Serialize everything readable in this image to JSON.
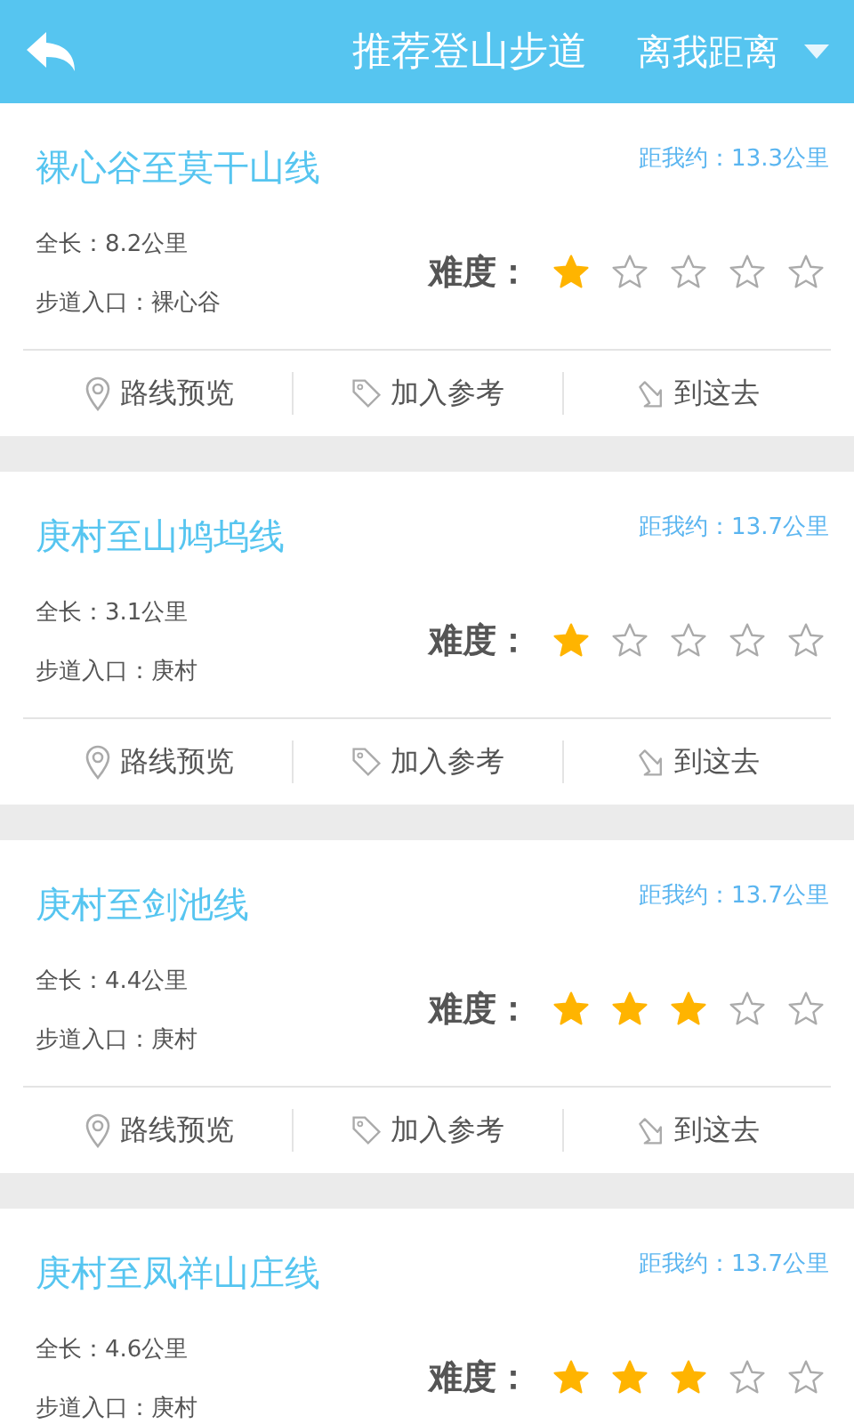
{
  "header": {
    "title": "推荐登山步道",
    "sort": "离我距离"
  },
  "routes": [
    {
      "name": "裸心谷至莫干山线",
      "distance": "距我约：13.3公里",
      "length": "全长：8.2公里",
      "entrance": "步道入口：裸心谷",
      "difficulty_label": "难度：",
      "stars": 1,
      "actions": [
        "路线预览",
        "加入参考",
        "到这去"
      ]
    },
    {
      "name": "庚村至山鸠坞线",
      "distance": "距我约：13.7公里",
      "length": "全长：3.1公里",
      "entrance": "步道入口：庚村",
      "difficulty_label": "难度：",
      "stars": 1,
      "actions": [
        "路线预览",
        "加入参考",
        "到这去"
      ]
    },
    {
      "name": "庚村至剑池线",
      "distance": "距我约：13.7公里",
      "length": "全长：4.4公里",
      "entrance": "步道入口：庚村",
      "difficulty_label": "难度：",
      "stars": 3,
      "actions": [
        "路线预览",
        "加入参考",
        "到这去"
      ]
    },
    {
      "name": "庚村至凤祥山庄线",
      "distance": "距我约：13.7公里",
      "length": "全长：4.6公里",
      "entrance": "步道入口：庚村",
      "difficulty_label": "难度：",
      "stars": 3
    }
  ]
}
